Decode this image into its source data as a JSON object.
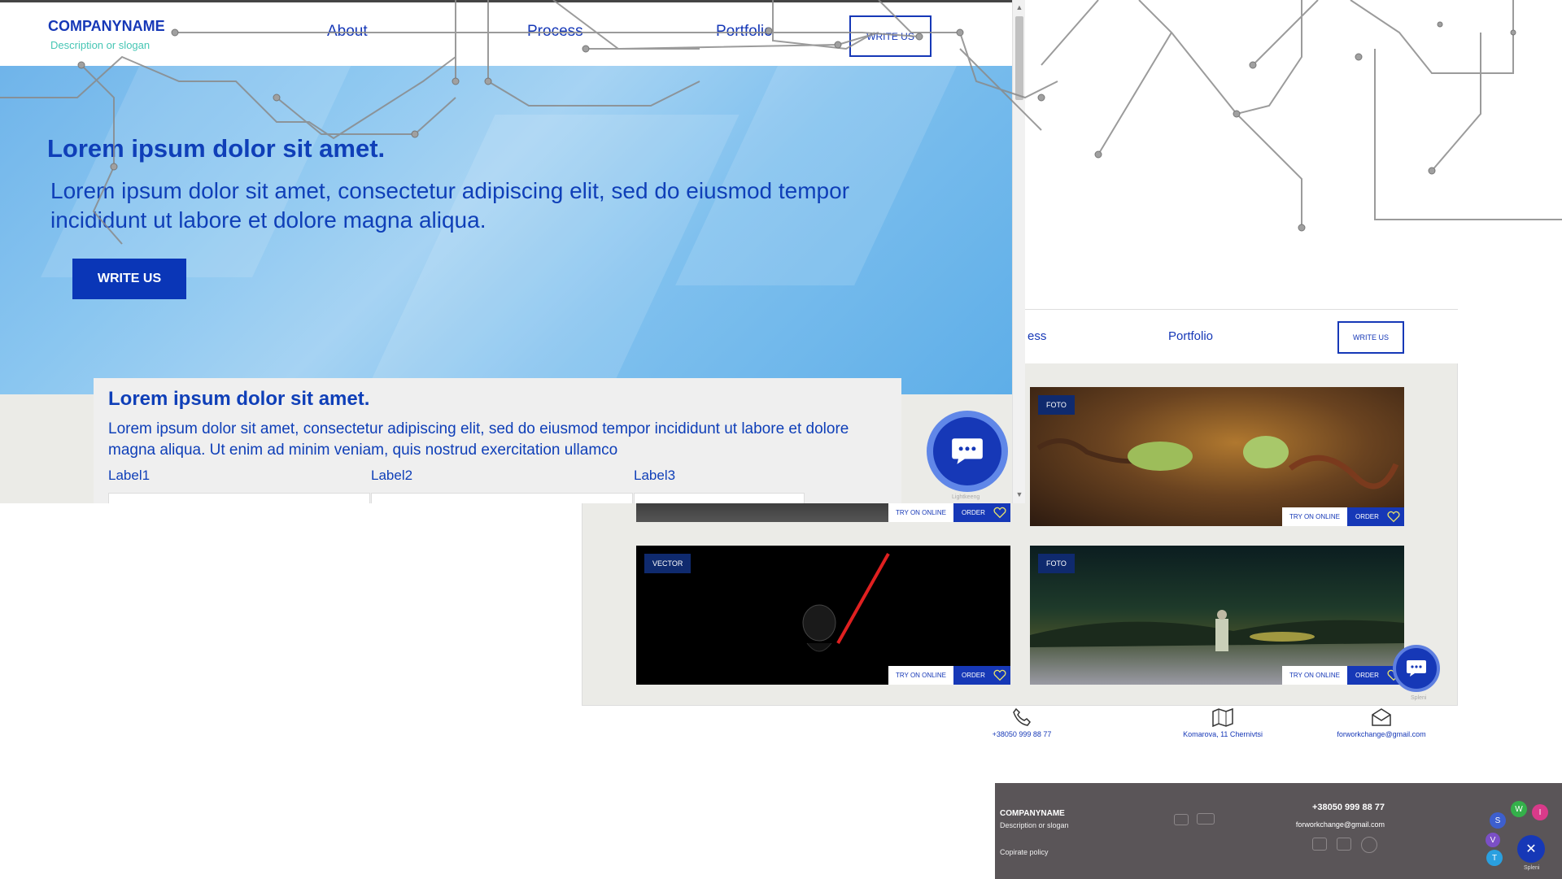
{
  "front": {
    "logo": "COMPANYNAME",
    "slogan": "Description or slogan",
    "nav": [
      "About",
      "Process",
      "Portfolio"
    ],
    "write_us": "WRITE US",
    "hero_title": "Lorem ipsum dolor sit amet.",
    "hero_text": "Lorem ipsum dolor sit amet, consectetur adipiscing elit, sed do eiusmod tempor incididunt ut labore et dolore magna aliqua.",
    "hero_button": "WRITE US",
    "form_title": "Lorem ipsum dolor sit amet.",
    "form_text": "Lorem ipsum dolor sit amet, consectetur adipiscing elit, sed do eiusmod tempor incididunt ut labore et dolore magna aliqua. Ut enim ad minim veniam, quis nostrud exercitation ullamco",
    "labels": [
      "Label1",
      "Label2",
      "Label3"
    ],
    "fab_caption": "Lightkeeng"
  },
  "portfolio": {
    "nav": [
      "ess",
      "Portfolio"
    ],
    "write_us": "WRITE US",
    "cards": [
      {
        "tag": "",
        "try": "TRY ON ONLINE",
        "order": "ORDER"
      },
      {
        "tag": "FOTO",
        "try": "TRY ON ONLINE",
        "order": "ORDER"
      },
      {
        "tag": "VECTOR",
        "try": "TRY ON ONLINE",
        "order": "ORDER"
      },
      {
        "tag": "FOTO",
        "try": "TRY ON ONLINE",
        "order": "ORDER"
      }
    ],
    "fab_caption": "Spleni"
  },
  "contacts": {
    "phone": "+38050 999 88 77",
    "address": "Komarova, 11 Chernivtsi",
    "email": "forworkchange@gmail.com"
  },
  "footer": {
    "company": "COMPANYNAME",
    "slogan": "Description or slogan",
    "policy": "Copirate policy",
    "phone": "+38050 999 88 77",
    "email": "forworkchange@gmail.com",
    "fab_caption": "Spleni"
  },
  "colors": {
    "brand_blue": "#1638b7",
    "teal": "#46c6b4",
    "footer_bg": "#5a5558",
    "card_tag": "#0f2a6e"
  }
}
